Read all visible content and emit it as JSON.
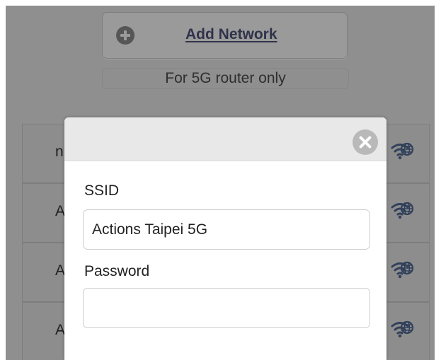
{
  "header": {
    "add_network_label": "Add Network",
    "note": "For 5G router only"
  },
  "networks": [
    {
      "initial": "n"
    },
    {
      "initial": "A"
    },
    {
      "initial": "A"
    },
    {
      "initial": "A"
    }
  ],
  "icons": {
    "add": "plus-circle-icon",
    "close": "close-circle-icon",
    "network_status": "wifi-globe-icon"
  },
  "dialog": {
    "ssid_label": "SSID",
    "ssid_value": "Actions Taipei 5G",
    "password_label": "Password",
    "password_value": ""
  },
  "colors": {
    "overlay": "#8f8f8f",
    "dialog_background": "#ffffff",
    "header_background": "#e8e8e8",
    "field_border": "#cdcdcd",
    "wifi_icon": "#31405a"
  }
}
